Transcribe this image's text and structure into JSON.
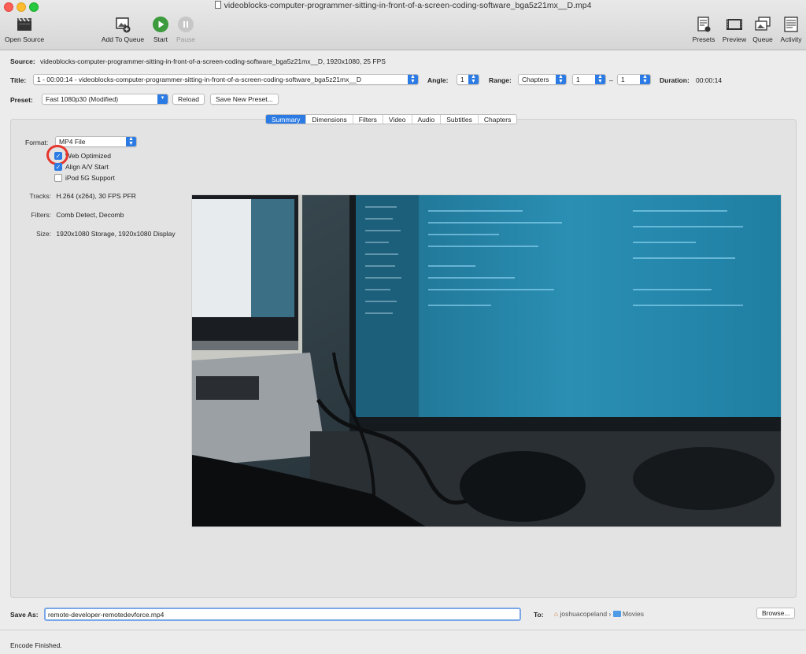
{
  "window": {
    "title": "videoblocks-computer-programmer-sitting-in-front-of-a-screen-coding-software_bga5z21mx__D.mp4"
  },
  "toolbar": {
    "open_source": "Open Source",
    "add_to_queue": "Add To Queue",
    "start": "Start",
    "pause": "Pause",
    "presets": "Presets",
    "preview": "Preview",
    "queue": "Queue",
    "activity": "Activity"
  },
  "source": {
    "label": "Source:",
    "value": "videoblocks-computer-programmer-sitting-in-front-of-a-screen-coding-software_bga5z21mx__D, 1920x1080, 25 FPS"
  },
  "title_row": {
    "label": "Title:",
    "value": "1 - 00:00:14 - videoblocks-computer-programmer-sitting-in-front-of-a-screen-coding-software_bga5z21mx__D",
    "angle_label": "Angle:",
    "angle_value": "1",
    "range_label": "Range:",
    "range_type": "Chapters",
    "range_start": "1",
    "range_sep": "–",
    "range_end": "1",
    "duration_label": "Duration:",
    "duration_value": "00:00:14"
  },
  "preset_row": {
    "label": "Preset:",
    "value": "Fast 1080p30 (Modified)",
    "reload": "Reload",
    "save_new": "Save New Preset..."
  },
  "tabs": [
    "Summary",
    "Dimensions",
    "Filters",
    "Video",
    "Audio",
    "Subtitles",
    "Chapters"
  ],
  "active_tab": "Summary",
  "summary": {
    "format_label": "Format:",
    "format_value": "MP4 File",
    "web_optimized": "Web Optimized",
    "align_av": "Align A/V Start",
    "ipod": "iPod 5G Support",
    "tracks_label": "Tracks:",
    "tracks_value": "H.264 (x264), 30 FPS PFR",
    "filters_label": "Filters:",
    "filters_value": "Comb Detect, Decomb",
    "size_label": "Size:",
    "size_value": "1920x1080 Storage, 1920x1080 Display"
  },
  "save": {
    "label": "Save As:",
    "filename": "remote-developer-remotedevforce.mp4",
    "to_label": "To:",
    "path_user": "joshuacopeland",
    "path_sep": "›",
    "path_folder": "Movies",
    "browse": "Browse..."
  },
  "status": "Encode Finished.",
  "colors": {
    "accent": "#2c7be5",
    "annotation_ring": "#e5362d"
  }
}
